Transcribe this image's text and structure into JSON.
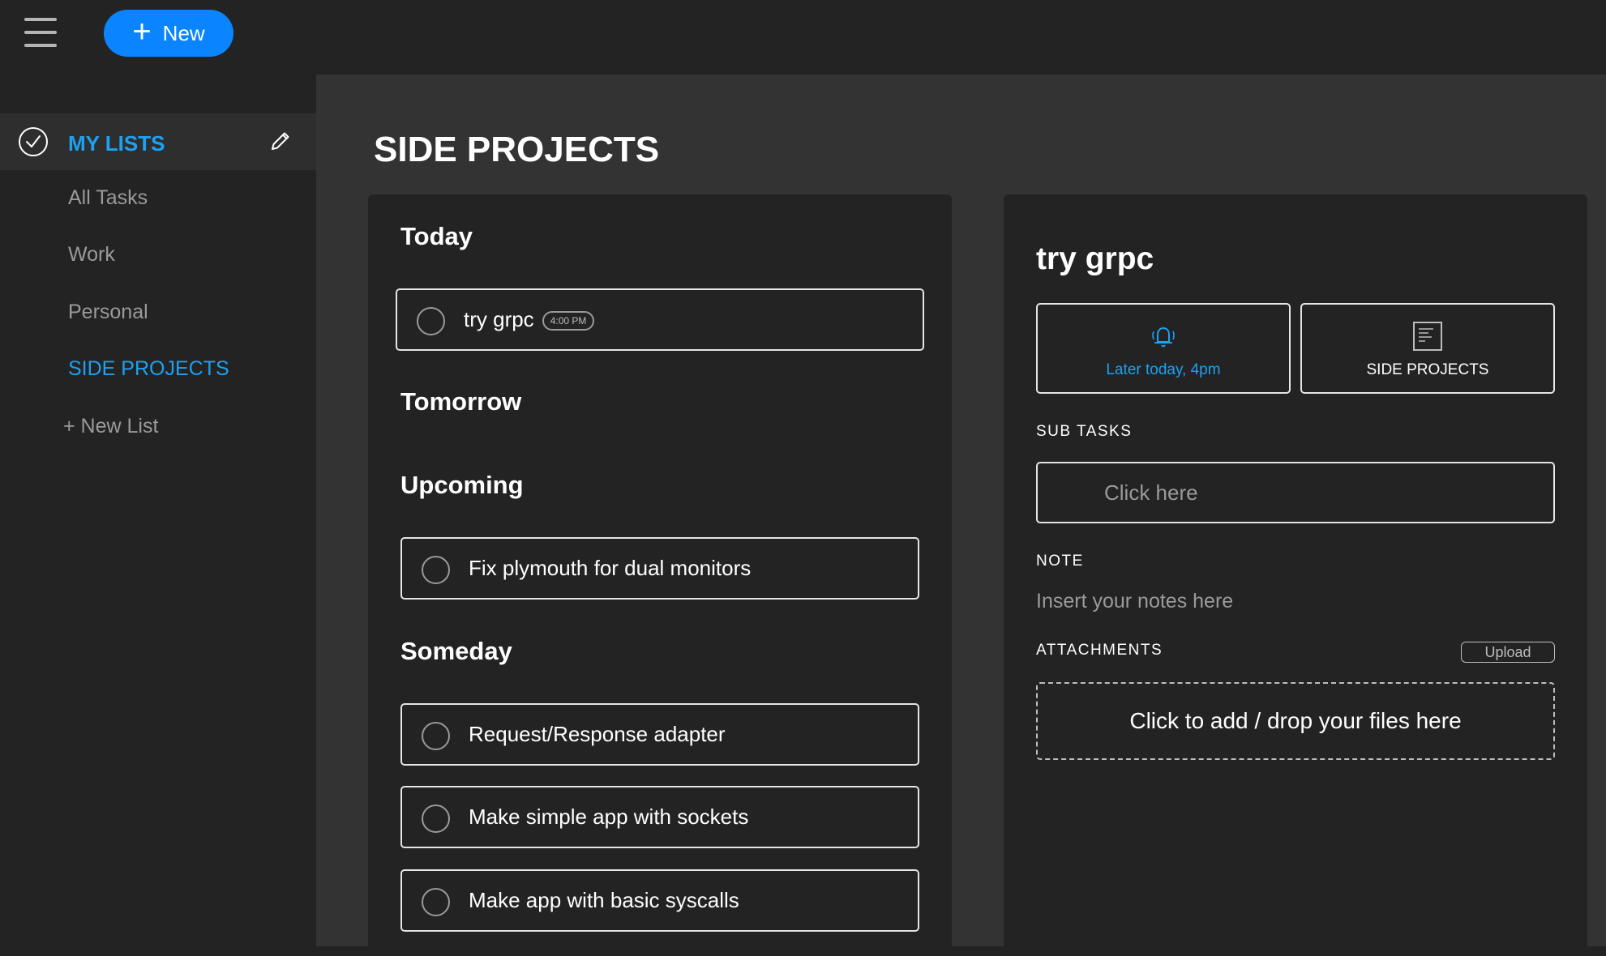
{
  "topbar": {
    "menu_icon": "hamburger-menu-icon",
    "new_button": {
      "icon": "plus-icon",
      "label": "New"
    }
  },
  "sidebar": {
    "header": {
      "icon": "check-circle-icon",
      "label": "MY LISTS",
      "edit_icon": "pencil-icon"
    },
    "items": [
      {
        "label": "All Tasks",
        "active": false
      },
      {
        "label": "Work",
        "active": false
      },
      {
        "label": "Personal",
        "active": false
      },
      {
        "label": "SIDE PROJECTS",
        "active": true
      }
    ],
    "new_list": "+ New List"
  },
  "main": {
    "title": "SIDE PROJECTS",
    "sections": [
      {
        "title": "Today",
        "tasks": [
          {
            "text": "try grpc",
            "badge": "4:00 PM",
            "selected": true
          }
        ]
      },
      {
        "title": "Tomorrow",
        "tasks": []
      },
      {
        "title": "Upcoming",
        "tasks": [
          {
            "text": "Fix plymouth for dual monitors"
          }
        ]
      },
      {
        "title": "Someday",
        "tasks": [
          {
            "text": "Request/Response adapter"
          },
          {
            "text": "Make simple app with sockets"
          },
          {
            "text": "Make app with basic syscalls"
          }
        ]
      }
    ]
  },
  "detail": {
    "title": "try grpc",
    "reminder": {
      "icon": "bell-icon",
      "label": "Later today, 4pm"
    },
    "list": {
      "icon": "list-document-icon",
      "label": "SIDE PROJECTS"
    },
    "subtasks": {
      "label": "SUB TASKS",
      "placeholder": "Click here"
    },
    "note": {
      "label": "NOTE",
      "placeholder": "Insert your notes here"
    },
    "attachments": {
      "label": "ATTACHMENTS",
      "upload_label": "Upload",
      "dropzone_text": "Click to add / drop your files here"
    }
  },
  "colors": {
    "accent": "#1da1f2",
    "new_button": "#0a84ff",
    "background": "#232323",
    "main_background": "#333333"
  }
}
